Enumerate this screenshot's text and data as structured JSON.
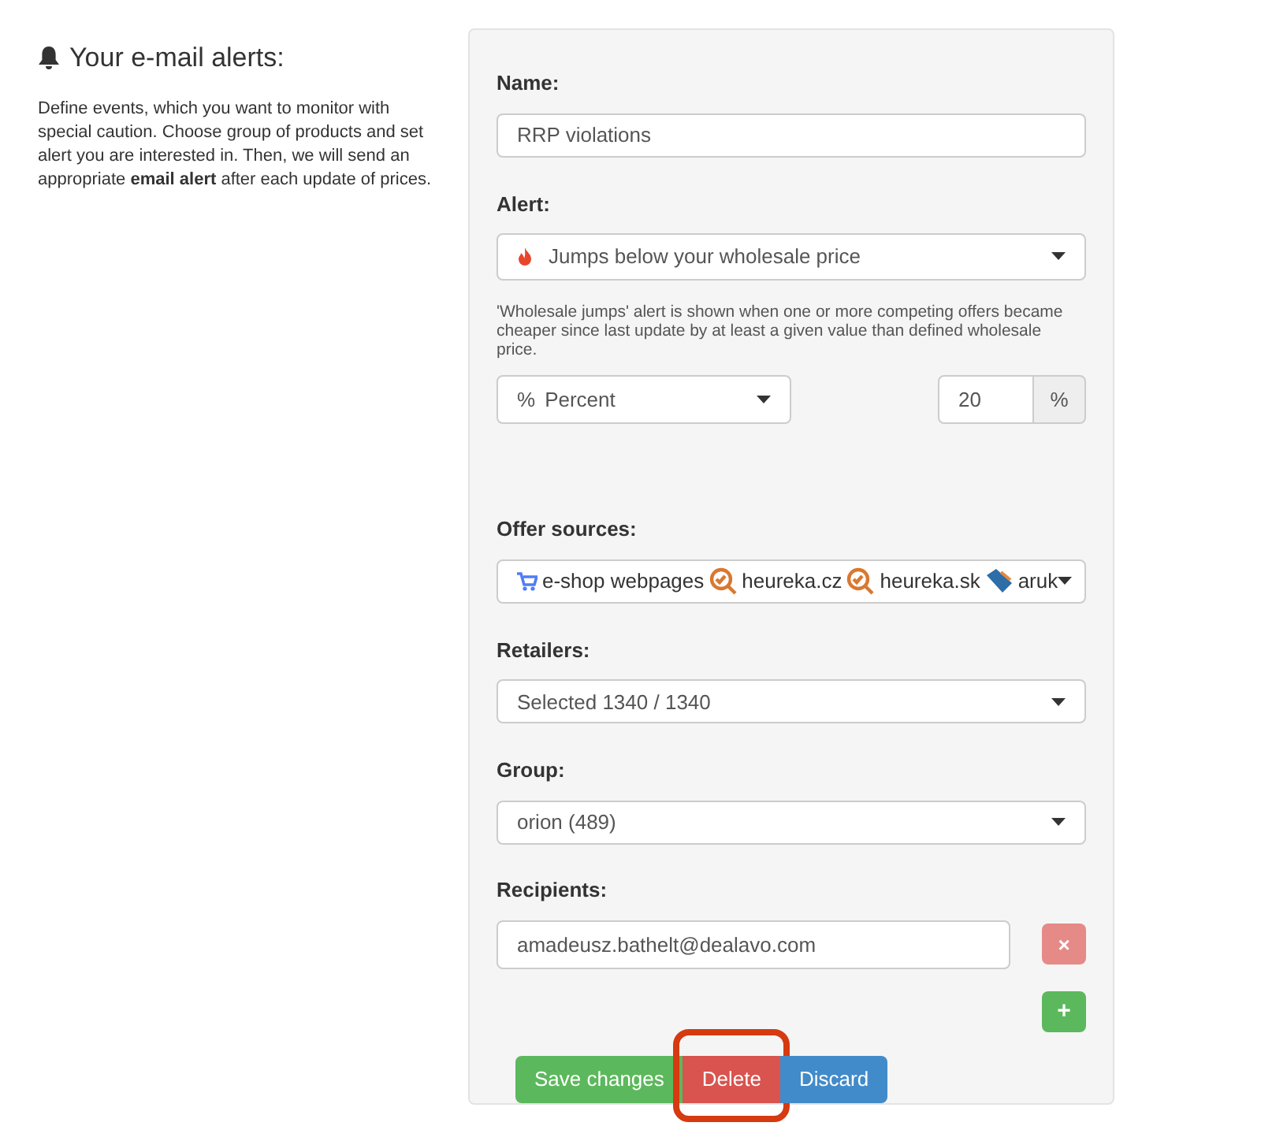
{
  "intro": {
    "title": "Your e-mail alerts:",
    "text": "Define events, which you want to monitor with special caution. Choose group of products and set alert you are interested in. Then, we will send an appropriate **email alert** after each update of prices."
  },
  "form": {
    "name": {
      "label": "Name:",
      "value": "RRP violations"
    },
    "alert": {
      "label": "Alert:",
      "value": "Jumps below your wholesale price",
      "help": "'Wholesale jumps' alert is shown when one or more competing offers became cheaper since last update by at least a given value than defined wholesale price.",
      "unit_select": {
        "symbol": "%",
        "value": "Percent"
      },
      "amount": {
        "value": "20",
        "addon": "%"
      }
    },
    "offer_sources": {
      "label": "Offer sources:",
      "items": [
        {
          "kind": "cart",
          "text": "e-shop webpages"
        },
        {
          "kind": "magnifier",
          "text": "heureka.cz"
        },
        {
          "kind": "magnifier",
          "text": "heureka.sk"
        },
        {
          "kind": "tag",
          "text": "aruk"
        }
      ]
    },
    "retailers": {
      "label": "Retailers:",
      "value": "Selected 1340 / 1340"
    },
    "group": {
      "label": "Group:",
      "value": "orion (489)"
    },
    "recipients": {
      "label": "Recipients:",
      "items": [
        {
          "value": "amadeusz.bathelt@dealavo.com",
          "remove": "×"
        }
      ],
      "add": "+"
    },
    "buttons": [
      {
        "kind": "save",
        "label": "Save changes",
        "highlighted": false
      },
      {
        "kind": "delete",
        "label": "Delete",
        "highlighted": true
      },
      {
        "kind": "discard",
        "label": "Discard",
        "highlighted": false
      }
    ]
  }
}
